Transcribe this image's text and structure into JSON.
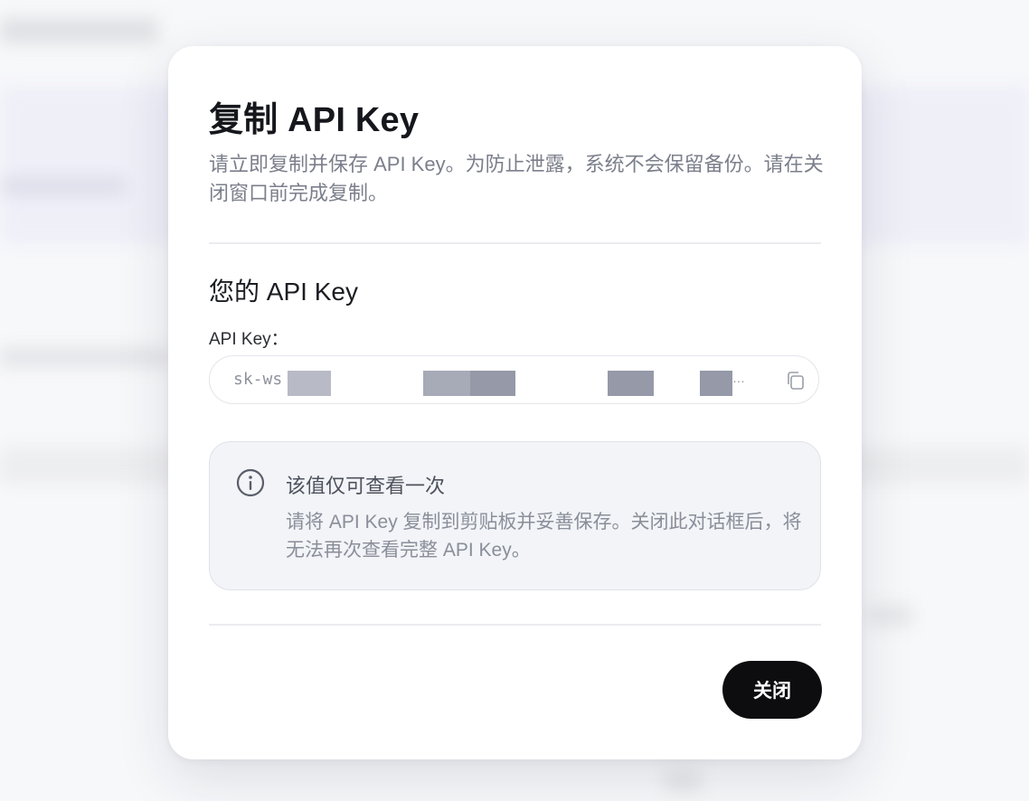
{
  "dialog": {
    "title": "复制 API Key",
    "description": "请立即复制并保存 API Key。为防止泄露，系统不会保留备份。请在关闭窗口前完成复制。",
    "section_title": "您的 API Key",
    "field_label": "API Key：",
    "key_visible_prefix": "sk-ws",
    "key_truncation": "…",
    "copy_icon": "copy-icon",
    "info": {
      "icon": "info-icon",
      "title": "该值仅可查看一次",
      "text": "请将 API Key 复制到剪贴板并妥善保存。关闭此对话框后，将无法再次查看完整 API Key。"
    },
    "close_label": "关闭"
  },
  "colors": {
    "primary_button": "#0d0d10",
    "info_background": "#f2f4f8",
    "redaction": "#9a9eab"
  }
}
